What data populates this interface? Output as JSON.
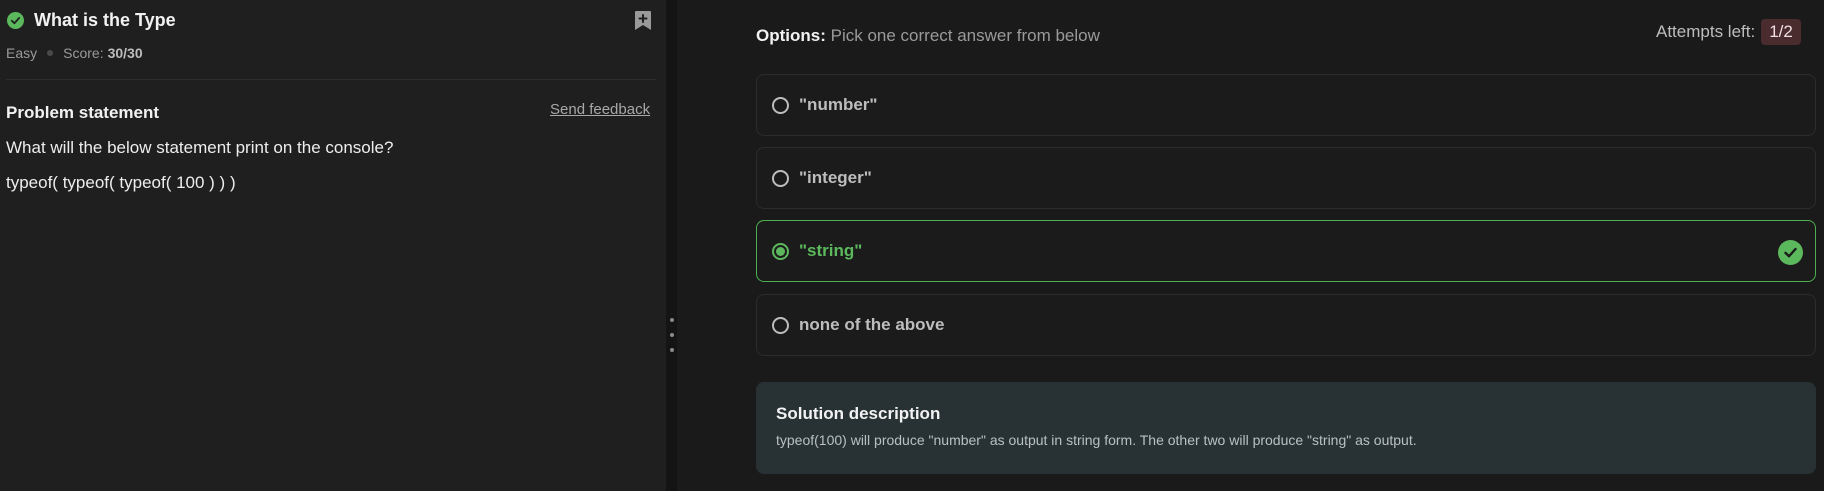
{
  "problem": {
    "title": "What is the Type",
    "difficulty": "Easy",
    "score_label": "Score:",
    "score_value": "30/30",
    "send_feedback": "Send feedback",
    "statement_heading": "Problem statement",
    "question": "What will the below statement print on the console?",
    "code": "typeof( typeof( typeof( 100 ) ) )",
    "icons": [
      "check-circle-icon",
      "bookmark-plus-icon"
    ]
  },
  "options": {
    "heading_label": "Options:",
    "heading_text": " Pick one correct answer from below",
    "attempts_label": "Attempts left:",
    "attempts_value": "1/2",
    "items": [
      {
        "label": "\"number\"",
        "selected": false,
        "correct": false
      },
      {
        "label": "\"integer\"",
        "selected": false,
        "correct": false
      },
      {
        "label": "\"string\"",
        "selected": true,
        "correct": true
      },
      {
        "label": "none of the above",
        "selected": false,
        "correct": false
      }
    ]
  },
  "solution": {
    "heading": "Solution description",
    "text": "typeof(100) will produce \"number\" as output in string form. The other two will produce \"string\" as output."
  },
  "colors": {
    "success": "#5cb85c",
    "attempts_badge_bg": "#4a2b2e",
    "solution_bg": "#283234"
  }
}
